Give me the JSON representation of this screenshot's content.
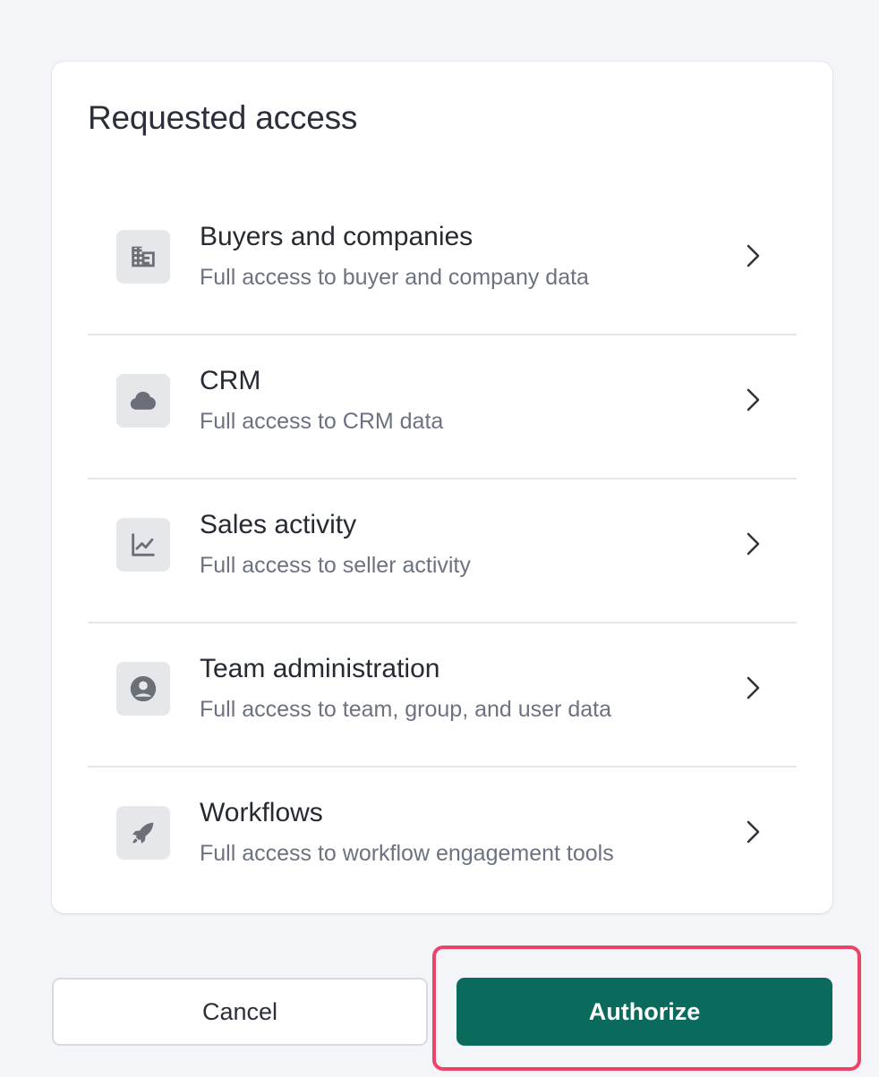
{
  "card": {
    "title": "Requested access"
  },
  "items": [
    {
      "title": "Buyers and companies",
      "description": "Full access to buyer and company data",
      "icon": "building-icon"
    },
    {
      "title": "CRM",
      "description": "Full access to CRM data",
      "icon": "cloud-icon"
    },
    {
      "title": "Sales activity",
      "description": "Full access to seller activity",
      "icon": "line-chart-icon"
    },
    {
      "title": "Team administration",
      "description": "Full access to team, group, and user data",
      "icon": "user-circle-icon"
    },
    {
      "title": "Workflows",
      "description": "Full access to workflow engagement tools",
      "icon": "rocket-icon"
    }
  ],
  "actions": {
    "cancel_label": "Cancel",
    "authorize_label": "Authorize"
  },
  "colors": {
    "primary": "#0a6b5c",
    "highlight": "#ec4468",
    "background": "#f4f5f8"
  }
}
